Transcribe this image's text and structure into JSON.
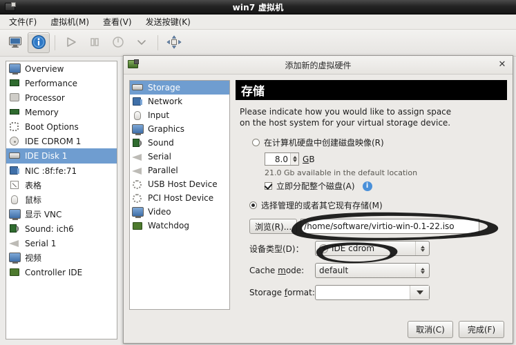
{
  "window": {
    "title": "win7 虚拟机",
    "icon": "computer-icon"
  },
  "menubar": [
    {
      "label": "文件(F)",
      "name": "menu-file"
    },
    {
      "label": "虚拟机(M)",
      "name": "menu-virtual-machine"
    },
    {
      "label": "查看(V)",
      "name": "menu-view"
    },
    {
      "label": "发送按键(K)",
      "name": "menu-send-key"
    }
  ],
  "toolbar": [
    {
      "name": "show-console-button",
      "icon": "monitor-icon",
      "active": false
    },
    {
      "name": "show-details-button",
      "icon": "info-icon",
      "active": true
    },
    {
      "name": "run-button",
      "icon": "play-icon",
      "active": false
    },
    {
      "name": "pause-button",
      "icon": "pause-icon",
      "active": false
    },
    {
      "name": "shutdown-button",
      "icon": "power-icon",
      "active": false
    },
    {
      "name": "shutdown-menu-button",
      "icon": "chevron-down-icon",
      "active": false
    },
    {
      "name": "fullscreen-button",
      "icon": "fullscreen-arrows-icon",
      "active": false
    }
  ],
  "hardware_list": [
    {
      "label": "Overview",
      "icon": "monitor-icon",
      "selected": false
    },
    {
      "label": "Performance",
      "icon": "performance-icon",
      "selected": false
    },
    {
      "label": "Processor",
      "icon": "cpu-icon",
      "selected": false
    },
    {
      "label": "Memory",
      "icon": "memory-icon",
      "selected": false
    },
    {
      "label": "Boot Options",
      "icon": "boot-icon",
      "selected": false
    },
    {
      "label": "IDE CDROM 1",
      "icon": "cdrom-icon",
      "selected": false
    },
    {
      "label": "IDE Disk 1",
      "icon": "harddisk-icon",
      "selected": true
    },
    {
      "label": "NIC :8f:fe:71",
      "icon": "network-card-icon",
      "selected": false
    },
    {
      "label": "表格",
      "icon": "tablet-icon",
      "selected": false
    },
    {
      "label": "鼠标",
      "icon": "mouse-icon",
      "selected": false
    },
    {
      "label": "显示 VNC",
      "icon": "display-icon",
      "selected": false
    },
    {
      "label": "Sound: ich6",
      "icon": "sound-icon",
      "selected": false
    },
    {
      "label": "Serial 1",
      "icon": "serial-icon",
      "selected": false
    },
    {
      "label": "视频",
      "icon": "video-icon",
      "selected": false
    },
    {
      "label": "Controller IDE",
      "icon": "controller-icon",
      "selected": false
    }
  ],
  "dialog": {
    "title": "添加新的虚拟硬件",
    "icon": "add-hardware-icon",
    "close_label": "✕",
    "categories": [
      {
        "label": "Storage",
        "icon": "harddisk-icon",
        "selected": true
      },
      {
        "label": "Network",
        "icon": "network-card-icon",
        "selected": false
      },
      {
        "label": "Input",
        "icon": "mouse-icon",
        "selected": false
      },
      {
        "label": "Graphics",
        "icon": "display-icon",
        "selected": false
      },
      {
        "label": "Sound",
        "icon": "sound-icon",
        "selected": false
      },
      {
        "label": "Serial",
        "icon": "serial-icon",
        "selected": false
      },
      {
        "label": "Parallel",
        "icon": "serial-icon",
        "selected": false
      },
      {
        "label": "USB Host Device",
        "icon": "gears-icon",
        "selected": false
      },
      {
        "label": "PCI Host Device",
        "icon": "gears-icon",
        "selected": false
      },
      {
        "label": "Video",
        "icon": "display-icon",
        "selected": false
      },
      {
        "label": "Watchdog",
        "icon": "watchdog-icon",
        "selected": false
      }
    ],
    "section_title": "存储",
    "description_line1": "Please indicate how you would like to assign space",
    "description_line2": "on the host system for your virtual storage device.",
    "option_create": {
      "label": "在计算机硬盘中创建磁盘映像(R)",
      "selected": false
    },
    "disk_size": {
      "value": "8.0",
      "unit": "GB"
    },
    "available_text": "21.0 Gb available in the default location",
    "allocate_now": {
      "label": "立即分配整个磁盘(A)",
      "checked": true,
      "info_glyph": "i"
    },
    "option_managed": {
      "label": "选择管理的或者其它现有存储(M)",
      "selected": true
    },
    "browse_button": "浏览(R)...",
    "storage_path": "/home/software/virtio-win-0.1-22.iso",
    "device_type": {
      "label": "设备类型(D)：",
      "value": "IDE cdrom",
      "icon": "cdrom-icon"
    },
    "cache_mode": {
      "label": "Cache mode:",
      "value": "default"
    },
    "storage_format": {
      "label": "Storage format:",
      "value": ""
    },
    "buttons": {
      "cancel": "取消(C)",
      "finish": "完成(F)"
    }
  },
  "annotation": {
    "color": "#101010",
    "shapes": [
      "ellipse-around-storage-path",
      "ellipse-around-device-type"
    ]
  }
}
